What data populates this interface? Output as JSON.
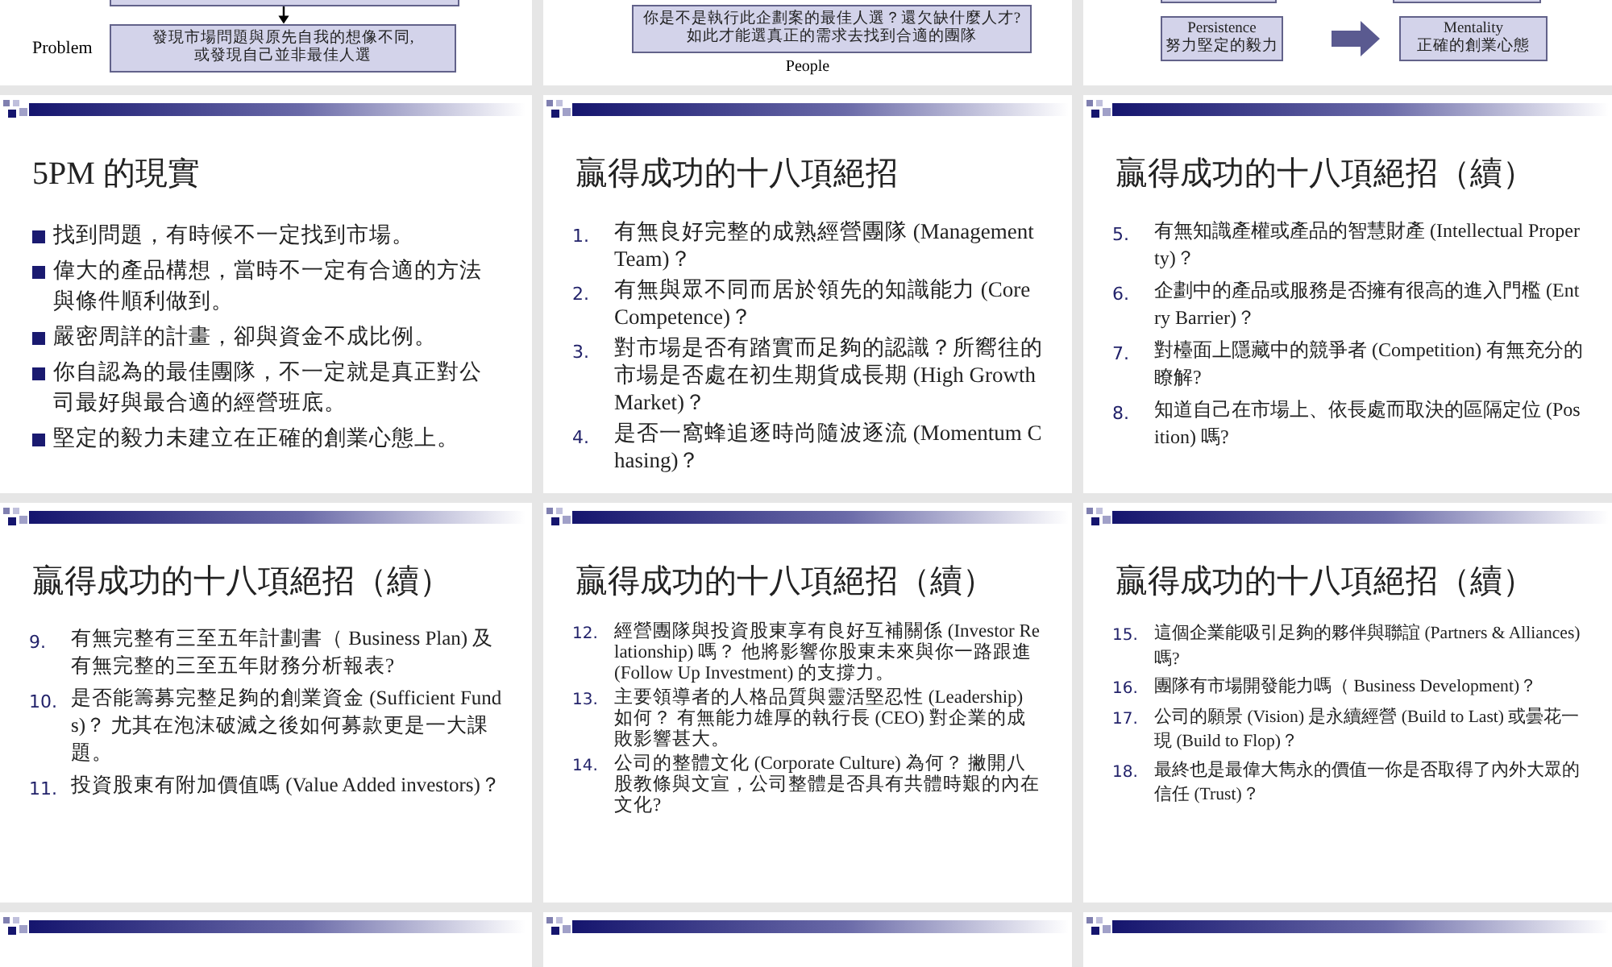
{
  "slides": [
    {
      "kind": "diagram_problem",
      "label": "Problem",
      "box_lines": [
        "發現市場問題與原先自我的想像不同,",
        "或發現自己並非最佳人選"
      ]
    },
    {
      "kind": "diagram_people",
      "box_lines": [
        "你是不是執行此企劃案的最佳人選？還欠缺什麼人才?",
        "如此才能選真正的需求去找到合適的團隊"
      ],
      "caption": "People"
    },
    {
      "kind": "diagram_pair",
      "left_lines": [
        "Persistence",
        "努力堅定的毅力"
      ],
      "right_lines": [
        "Mentality",
        "正確的創業心態"
      ]
    },
    {
      "kind": "bullets",
      "title": "5PM 的現實",
      "items": [
        "找到問題，有時候不一定找到市場。",
        "偉大的產品構想，當時不一定有合適的方法與條件順利做到。",
        "嚴密周詳的計畫，卻與資金不成比例。",
        "你自認為的最佳團隊，不一定就是真正對公司最好與最合適的經營班底。",
        "堅定的毅力未建立在正確的創業心態上。"
      ]
    },
    {
      "kind": "numbered",
      "title": "贏得成功的十八項絕招",
      "items": [
        {
          "number": "1.",
          "text": "有無良好完整的成熟經營團隊 (Management Team)？"
        },
        {
          "number": "2.",
          "text": "有無與眾不同而居於領先的知識能力 (Core Competence)？"
        },
        {
          "number": "3.",
          "text": "對市場是否有踏實而足夠的認識？所嚮往的市場是否處在初生期貨成長期 (High Growth Market)？"
        },
        {
          "number": "4.",
          "text": "是否一窩蜂追逐時尚隨波逐流 (Momentum Chasing)？"
        }
      ]
    },
    {
      "kind": "numbered",
      "title": "贏得成功的十八項絕招（續）",
      "items": [
        {
          "number": "5.",
          "text": "有無知識產權或產品的智慧財產 (Intellectual Property)？"
        },
        {
          "number": "6.",
          "text": "企劃中的產品或服務是否擁有很高的進入門檻 (Entry Barrier)？"
        },
        {
          "number": "7.",
          "text": "對檯面上隱藏中的競爭者 (Competition) 有無充分的瞭解?"
        },
        {
          "number": "8.",
          "text": "知道自己在市場上、依長處而取決的區隔定位 (Position) 嗎?"
        }
      ]
    },
    {
      "kind": "numbered",
      "title": "贏得成功的十八項絕招（續）",
      "items": [
        {
          "number": "9.",
          "text": "有無完整有三至五年計劃書（ Business Plan) 及有無完整的三至五年財務分析報表?"
        },
        {
          "number": "10.",
          "text": "是否能籌募完整足夠的創業資金 (Sufficient Funds)？ 尤其在泡沫破滅之後如何募款更是一大課題。"
        },
        {
          "number": "11.",
          "text": "投資股東有附加價值嗎 (Value Added investors)？"
        }
      ]
    },
    {
      "kind": "numbered",
      "title": "贏得成功的十八項絕招（續）",
      "items": [
        {
          "number": "12.",
          "text": "經營團隊與投資股東享有良好互補關係 (Investor Relationship) 嗎？ 他將影響你股東未來與你一路跟進 (Follow Up Investment) 的支撐力。"
        },
        {
          "number": "13.",
          "text": "主要領導者的人格品質與靈活堅忍性 (Leadership) 如何？ 有無能力雄厚的執行長 (CEO) 對企業的成敗影響甚大。"
        },
        {
          "number": "14.",
          "text": "公司的整體文化 (Corporate Culture) 為何？ 撇開八股教條與文宣，公司整體是否具有共體時艱的內在文化?"
        }
      ]
    },
    {
      "kind": "numbered",
      "title": "贏得成功的十八項絕招（續）",
      "items": [
        {
          "number": "15.",
          "text": "這個企業能吸引足夠的夥伴與聯誼 (Partners & Alliances) 嗎?"
        },
        {
          "number": "16.",
          "text": "團隊有市場開發能力嗎（ Business Development)？"
        },
        {
          "number": "17.",
          "text": "公司的願景 (Vision) 是永續經營 (Build to Last) 或曇花一現 (Build to Flop)？"
        },
        {
          "number": "18.",
          "text": "最終也是最偉大雋永的價值一你是否取得了內外大眾的信任 (Trust)？"
        }
      ]
    },
    {
      "kind": "header_only"
    },
    {
      "kind": "header_only"
    },
    {
      "kind": "header_only"
    }
  ]
}
